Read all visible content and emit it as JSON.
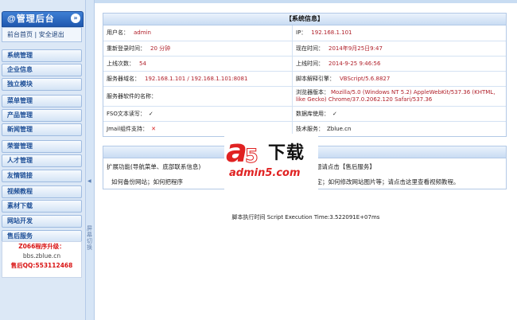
{
  "sidebar": {
    "title": "@管理后台",
    "collapse_icon": "chevron-double-up-icon",
    "quick_links": {
      "home": "前台首页",
      "separator": " | ",
      "logout": "安全退出"
    },
    "menu": [
      "系统管理",
      "企业信息",
      "独立模块",
      "菜单管理",
      "产品管理",
      "新闻管理",
      "荣誉管理",
      "人才管理",
      "友情链接",
      "视频教程",
      "素材下载",
      "网站开发",
      "售后服务"
    ],
    "support": {
      "upgrade": "Z066程序升级：",
      "site": "bbs.zblue.cn",
      "qq": "售后QQ:553112468"
    }
  },
  "splitter": {
    "arrow": "◀",
    "label": "屏幕切换"
  },
  "system_info": {
    "title": "【系统信息】",
    "rows": [
      {
        "left_label": "用户名：",
        "left_value": "admin",
        "right_label": "IP：",
        "right_value": "192.168.1.101"
      },
      {
        "left_label": "重新登录时间：",
        "left_value": "20 分钟",
        "right_label": "现在时间：",
        "right_value": "2014年9月25日9:47"
      },
      {
        "left_label": "上线次数：",
        "left_value": "54",
        "right_label": "上线时间：",
        "right_value": "2014-9-25 9:46:56"
      },
      {
        "left_label": "服务器域名：",
        "left_value": "192.168.1.101 / 192.168.1.101:8081",
        "right_label": "脚本解释引擎：",
        "right_value": "VBScript/5.6.8827"
      },
      {
        "left_label": "服务器软件的名称：",
        "left_value": "",
        "right_label": "浏览器版本：",
        "right_value": "Mozilla/5.0 (Windows NT 5.2) AppleWebKit/537.36 (KHTML, like Gecko) Chrome/37.0.2062.120 Safari/537.36"
      },
      {
        "left_label": "FSO文本读写：",
        "left_value": "✓",
        "right_label": "数据库使用：",
        "right_value": "✓"
      },
      {
        "left_label": "Jmail组件支持：",
        "left_value": "✕",
        "right_label": "技术服务：",
        "right_value": "Zblue.cn"
      }
    ]
  },
  "help": {
    "title": "务】",
    "line1_left": "扩展功能(导航菜单、底部联系信息)",
    "line1_right": "问题请点击【售后服务】",
    "line2_left": "如何备份网站；如何把程序",
    "line2_right": "解析绑定；如何修改网站图片等；请点击这里查看视频教程。"
  },
  "footer": {
    "exec_time": "脚本执行时间 Script Execution Time:3.522091E+07ms"
  },
  "watermark": {
    "logo": "a",
    "five": "5",
    "brand": "下载",
    "url": "admin5.com"
  },
  "colors": {
    "accent": "#1f59b0",
    "value_red": "#b0202a",
    "support_red": "#d91414",
    "watermark_red": "#e02222"
  }
}
